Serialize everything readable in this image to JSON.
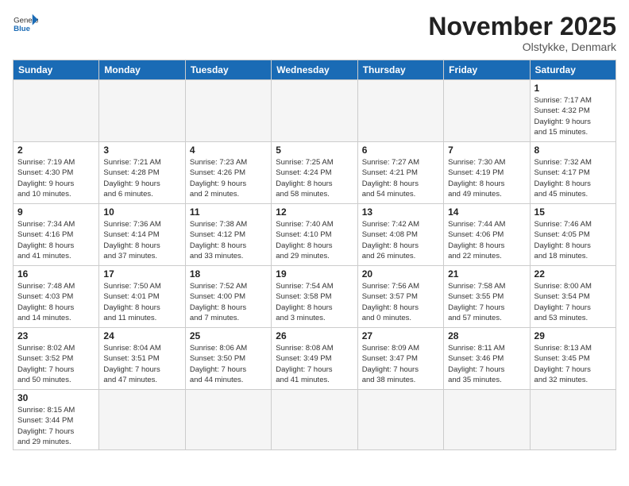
{
  "header": {
    "logo_general": "General",
    "logo_blue": "Blue",
    "month_title": "November 2025",
    "location": "Olstykke, Denmark"
  },
  "weekdays": [
    "Sunday",
    "Monday",
    "Tuesday",
    "Wednesday",
    "Thursday",
    "Friday",
    "Saturday"
  ],
  "weeks": [
    [
      {
        "day": "",
        "info": "",
        "empty": true
      },
      {
        "day": "",
        "info": "",
        "empty": true
      },
      {
        "day": "",
        "info": "",
        "empty": true
      },
      {
        "day": "",
        "info": "",
        "empty": true
      },
      {
        "day": "",
        "info": "",
        "empty": true
      },
      {
        "day": "",
        "info": "",
        "empty": true
      },
      {
        "day": "1",
        "info": "Sunrise: 7:17 AM\nSunset: 4:32 PM\nDaylight: 9 hours\nand 15 minutes."
      }
    ],
    [
      {
        "day": "2",
        "info": "Sunrise: 7:19 AM\nSunset: 4:30 PM\nDaylight: 9 hours\nand 10 minutes."
      },
      {
        "day": "3",
        "info": "Sunrise: 7:21 AM\nSunset: 4:28 PM\nDaylight: 9 hours\nand 6 minutes."
      },
      {
        "day": "4",
        "info": "Sunrise: 7:23 AM\nSunset: 4:26 PM\nDaylight: 9 hours\nand 2 minutes."
      },
      {
        "day": "5",
        "info": "Sunrise: 7:25 AM\nSunset: 4:24 PM\nDaylight: 8 hours\nand 58 minutes."
      },
      {
        "day": "6",
        "info": "Sunrise: 7:27 AM\nSunset: 4:21 PM\nDaylight: 8 hours\nand 54 minutes."
      },
      {
        "day": "7",
        "info": "Sunrise: 7:30 AM\nSunset: 4:19 PM\nDaylight: 8 hours\nand 49 minutes."
      },
      {
        "day": "8",
        "info": "Sunrise: 7:32 AM\nSunset: 4:17 PM\nDaylight: 8 hours\nand 45 minutes."
      }
    ],
    [
      {
        "day": "9",
        "info": "Sunrise: 7:34 AM\nSunset: 4:16 PM\nDaylight: 8 hours\nand 41 minutes."
      },
      {
        "day": "10",
        "info": "Sunrise: 7:36 AM\nSunset: 4:14 PM\nDaylight: 8 hours\nand 37 minutes."
      },
      {
        "day": "11",
        "info": "Sunrise: 7:38 AM\nSunset: 4:12 PM\nDaylight: 8 hours\nand 33 minutes."
      },
      {
        "day": "12",
        "info": "Sunrise: 7:40 AM\nSunset: 4:10 PM\nDaylight: 8 hours\nand 29 minutes."
      },
      {
        "day": "13",
        "info": "Sunrise: 7:42 AM\nSunset: 4:08 PM\nDaylight: 8 hours\nand 26 minutes."
      },
      {
        "day": "14",
        "info": "Sunrise: 7:44 AM\nSunset: 4:06 PM\nDaylight: 8 hours\nand 22 minutes."
      },
      {
        "day": "15",
        "info": "Sunrise: 7:46 AM\nSunset: 4:05 PM\nDaylight: 8 hours\nand 18 minutes."
      }
    ],
    [
      {
        "day": "16",
        "info": "Sunrise: 7:48 AM\nSunset: 4:03 PM\nDaylight: 8 hours\nand 14 minutes."
      },
      {
        "day": "17",
        "info": "Sunrise: 7:50 AM\nSunset: 4:01 PM\nDaylight: 8 hours\nand 11 minutes."
      },
      {
        "day": "18",
        "info": "Sunrise: 7:52 AM\nSunset: 4:00 PM\nDaylight: 8 hours\nand 7 minutes."
      },
      {
        "day": "19",
        "info": "Sunrise: 7:54 AM\nSunset: 3:58 PM\nDaylight: 8 hours\nand 3 minutes."
      },
      {
        "day": "20",
        "info": "Sunrise: 7:56 AM\nSunset: 3:57 PM\nDaylight: 8 hours\nand 0 minutes."
      },
      {
        "day": "21",
        "info": "Sunrise: 7:58 AM\nSunset: 3:55 PM\nDaylight: 7 hours\nand 57 minutes."
      },
      {
        "day": "22",
        "info": "Sunrise: 8:00 AM\nSunset: 3:54 PM\nDaylight: 7 hours\nand 53 minutes."
      }
    ],
    [
      {
        "day": "23",
        "info": "Sunrise: 8:02 AM\nSunset: 3:52 PM\nDaylight: 7 hours\nand 50 minutes."
      },
      {
        "day": "24",
        "info": "Sunrise: 8:04 AM\nSunset: 3:51 PM\nDaylight: 7 hours\nand 47 minutes."
      },
      {
        "day": "25",
        "info": "Sunrise: 8:06 AM\nSunset: 3:50 PM\nDaylight: 7 hours\nand 44 minutes."
      },
      {
        "day": "26",
        "info": "Sunrise: 8:08 AM\nSunset: 3:49 PM\nDaylight: 7 hours\nand 41 minutes."
      },
      {
        "day": "27",
        "info": "Sunrise: 8:09 AM\nSunset: 3:47 PM\nDaylight: 7 hours\nand 38 minutes."
      },
      {
        "day": "28",
        "info": "Sunrise: 8:11 AM\nSunset: 3:46 PM\nDaylight: 7 hours\nand 35 minutes."
      },
      {
        "day": "29",
        "info": "Sunrise: 8:13 AM\nSunset: 3:45 PM\nDaylight: 7 hours\nand 32 minutes."
      }
    ],
    [
      {
        "day": "30",
        "info": "Sunrise: 8:15 AM\nSunset: 3:44 PM\nDaylight: 7 hours\nand 29 minutes.",
        "last": true
      },
      {
        "day": "",
        "info": "",
        "empty": true,
        "last": true
      },
      {
        "day": "",
        "info": "",
        "empty": true,
        "last": true
      },
      {
        "day": "",
        "info": "",
        "empty": true,
        "last": true
      },
      {
        "day": "",
        "info": "",
        "empty": true,
        "last": true
      },
      {
        "day": "",
        "info": "",
        "empty": true,
        "last": true
      },
      {
        "day": "",
        "info": "",
        "empty": true,
        "last": true
      }
    ]
  ]
}
